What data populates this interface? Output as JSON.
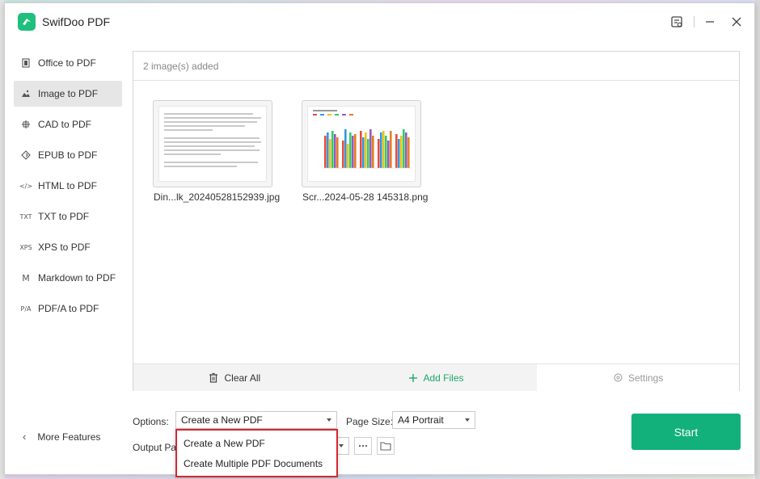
{
  "app": {
    "title": "SwifDoo PDF"
  },
  "sidebar": {
    "items": [
      {
        "label": "Office to PDF",
        "icon": "office-icon",
        "active": false
      },
      {
        "label": "Image to PDF",
        "icon": "image-icon",
        "active": true
      },
      {
        "label": "CAD to PDF",
        "icon": "cad-icon",
        "active": false
      },
      {
        "label": "EPUB to PDF",
        "icon": "epub-icon",
        "active": false
      },
      {
        "label": "HTML to PDF",
        "icon": "html-icon",
        "active": false
      },
      {
        "label": "TXT to PDF",
        "icon": "txt-icon",
        "active": false
      },
      {
        "label": "XPS to PDF",
        "icon": "xps-icon",
        "active": false
      },
      {
        "label": "Markdown to PDF",
        "icon": "markdown-icon",
        "active": false
      },
      {
        "label": "PDF/A to PDF",
        "icon": "pdfa-icon",
        "active": false
      }
    ],
    "icon_text": {
      "html": "</>",
      "txt": "TXT",
      "xps": "XPS",
      "markdown": "M",
      "pdfa": "P/A"
    },
    "more_features": "More Features"
  },
  "file_panel": {
    "count_text": "2 image(s) added",
    "files": [
      {
        "name": "Din...lk_20240528152939.jpg",
        "kind": "document-thumbnail"
      },
      {
        "name": "Scr...2024-05-28 145318.png",
        "kind": "chart-thumbnail"
      }
    ],
    "actions": {
      "clear_all": "Clear All",
      "add_files": "Add Files",
      "settings": "Settings"
    }
  },
  "options": {
    "options_label": "Options:",
    "options_value": "Create a New PDF",
    "page_size_label": "Page Size:",
    "page_size_value": "A4 Portrait",
    "output_path_label": "Output Pat",
    "dropdown_items": [
      "Create a New PDF",
      "Create Multiple PDF Documents"
    ]
  },
  "start": {
    "label": "Start"
  },
  "colors": {
    "brand": "#1fbf7e",
    "start_button": "#12b07a",
    "add_files": "#1fa86a",
    "dropdown_highlight": "#d6262f"
  }
}
